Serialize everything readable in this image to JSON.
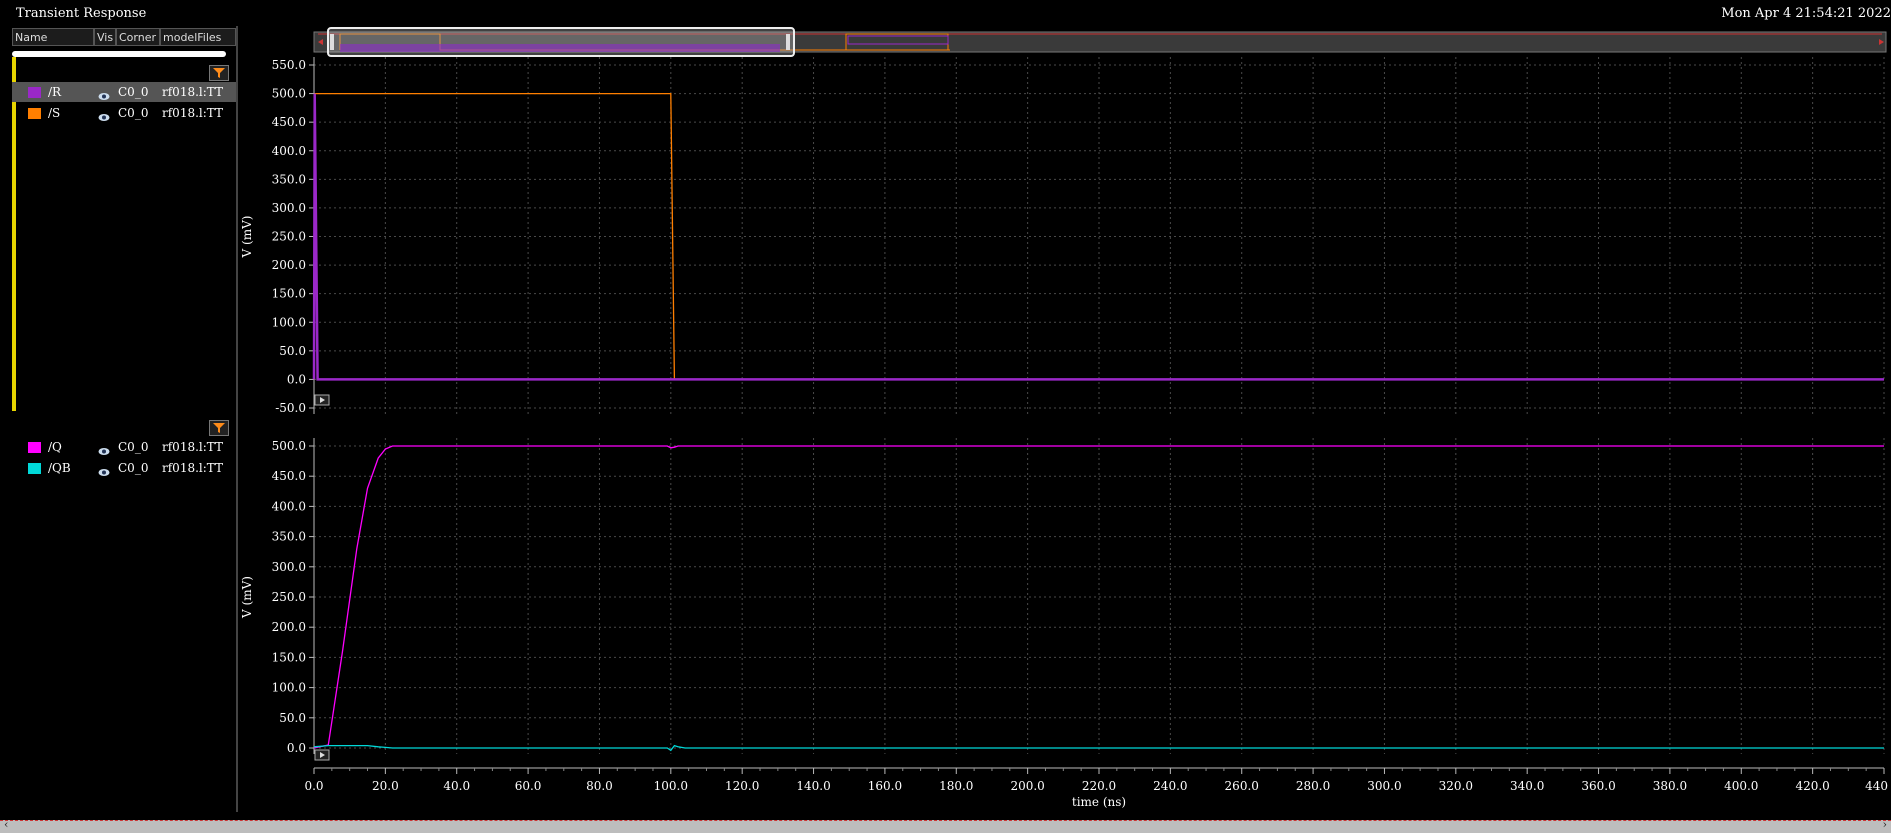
{
  "window": {
    "title": "Transient Response",
    "datetime": "Mon Apr 4 21:54:21 2022"
  },
  "sidebar": {
    "columns": [
      "Name",
      "Vis",
      "Corner",
      "modelFiles"
    ],
    "groups": [
      {
        "signals": [
          {
            "name": "/R",
            "color": "#9a28c8",
            "corner": "C0_0",
            "model": "rf018.l:TT",
            "selected": true
          },
          {
            "name": "/S",
            "color": "#ff7f00",
            "corner": "C0_0",
            "model": "rf018.l:TT",
            "selected": false
          }
        ]
      },
      {
        "signals": [
          {
            "name": "/Q",
            "color": "#ff00ff",
            "corner": "C0_0",
            "model": "rf018.l:TT",
            "selected": false
          },
          {
            "name": "/QB",
            "color": "#00d8d8",
            "corner": "C0_0",
            "model": "rf018.l:TT",
            "selected": false
          }
        ]
      }
    ]
  },
  "chart_data": {
    "type": "line",
    "xlabel": "time (ns)",
    "xlim": [
      0,
      440
    ],
    "xticks": [
      "0.0",
      "20.0",
      "40.0",
      "60.0",
      "80.0",
      "100.0",
      "120.0",
      "140.0",
      "160.0",
      "180.0",
      "200.0",
      "220.0",
      "240.0",
      "260.0",
      "280.0",
      "300.0",
      "320.0",
      "340.0",
      "360.0",
      "380.0",
      "400.0",
      "420.0",
      "440"
    ],
    "grid": true,
    "strips": [
      {
        "ylabel": "V (mV)",
        "ylim": [
          -50,
          550
        ],
        "yticks": [
          "550.0",
          "500.0",
          "450.0",
          "400.0",
          "350.0",
          "300.0",
          "250.0",
          "200.0",
          "150.0",
          "100.0",
          "50.0",
          "0.0",
          "-50.0"
        ],
        "series": [
          {
            "name": "/S",
            "color": "#ff7f00",
            "x": [
              0,
              0.3,
              100,
              101,
              440
            ],
            "y": [
              0,
              500,
              500,
              0,
              0
            ]
          },
          {
            "name": "/R",
            "color": "#9a28c8",
            "x": [
              0,
              0.2,
              1,
              440
            ],
            "y": [
              0,
              500,
              0,
              0
            ]
          }
        ]
      },
      {
        "ylabel": "V (mV)",
        "ylim": [
          -20,
          520
        ],
        "yticks": [
          "500.0",
          "450.0",
          "400.0",
          "350.0",
          "300.0",
          "250.0",
          "200.0",
          "150.0",
          "100.0",
          "50.0",
          "0.0"
        ],
        "series": [
          {
            "name": "/Q",
            "color": "#ff00ff",
            "x": [
              0,
              4,
              8,
              12,
              15,
              18,
              20,
              22,
              99,
              100,
              101,
              102,
              104,
              440
            ],
            "y": [
              0,
              5,
              160,
              330,
              430,
              480,
              495,
              500,
              500,
              497,
              498,
              500,
              500,
              500
            ]
          },
          {
            "name": "/QB",
            "color": "#00d8d8",
            "x": [
              0,
              4,
              15,
              18,
              22,
              99,
              100,
              101,
              102,
              104,
              440
            ],
            "y": [
              2,
              4,
              4,
              2,
              0,
              0,
              -4,
              4,
              2,
              0,
              0
            ]
          }
        ]
      }
    ]
  }
}
